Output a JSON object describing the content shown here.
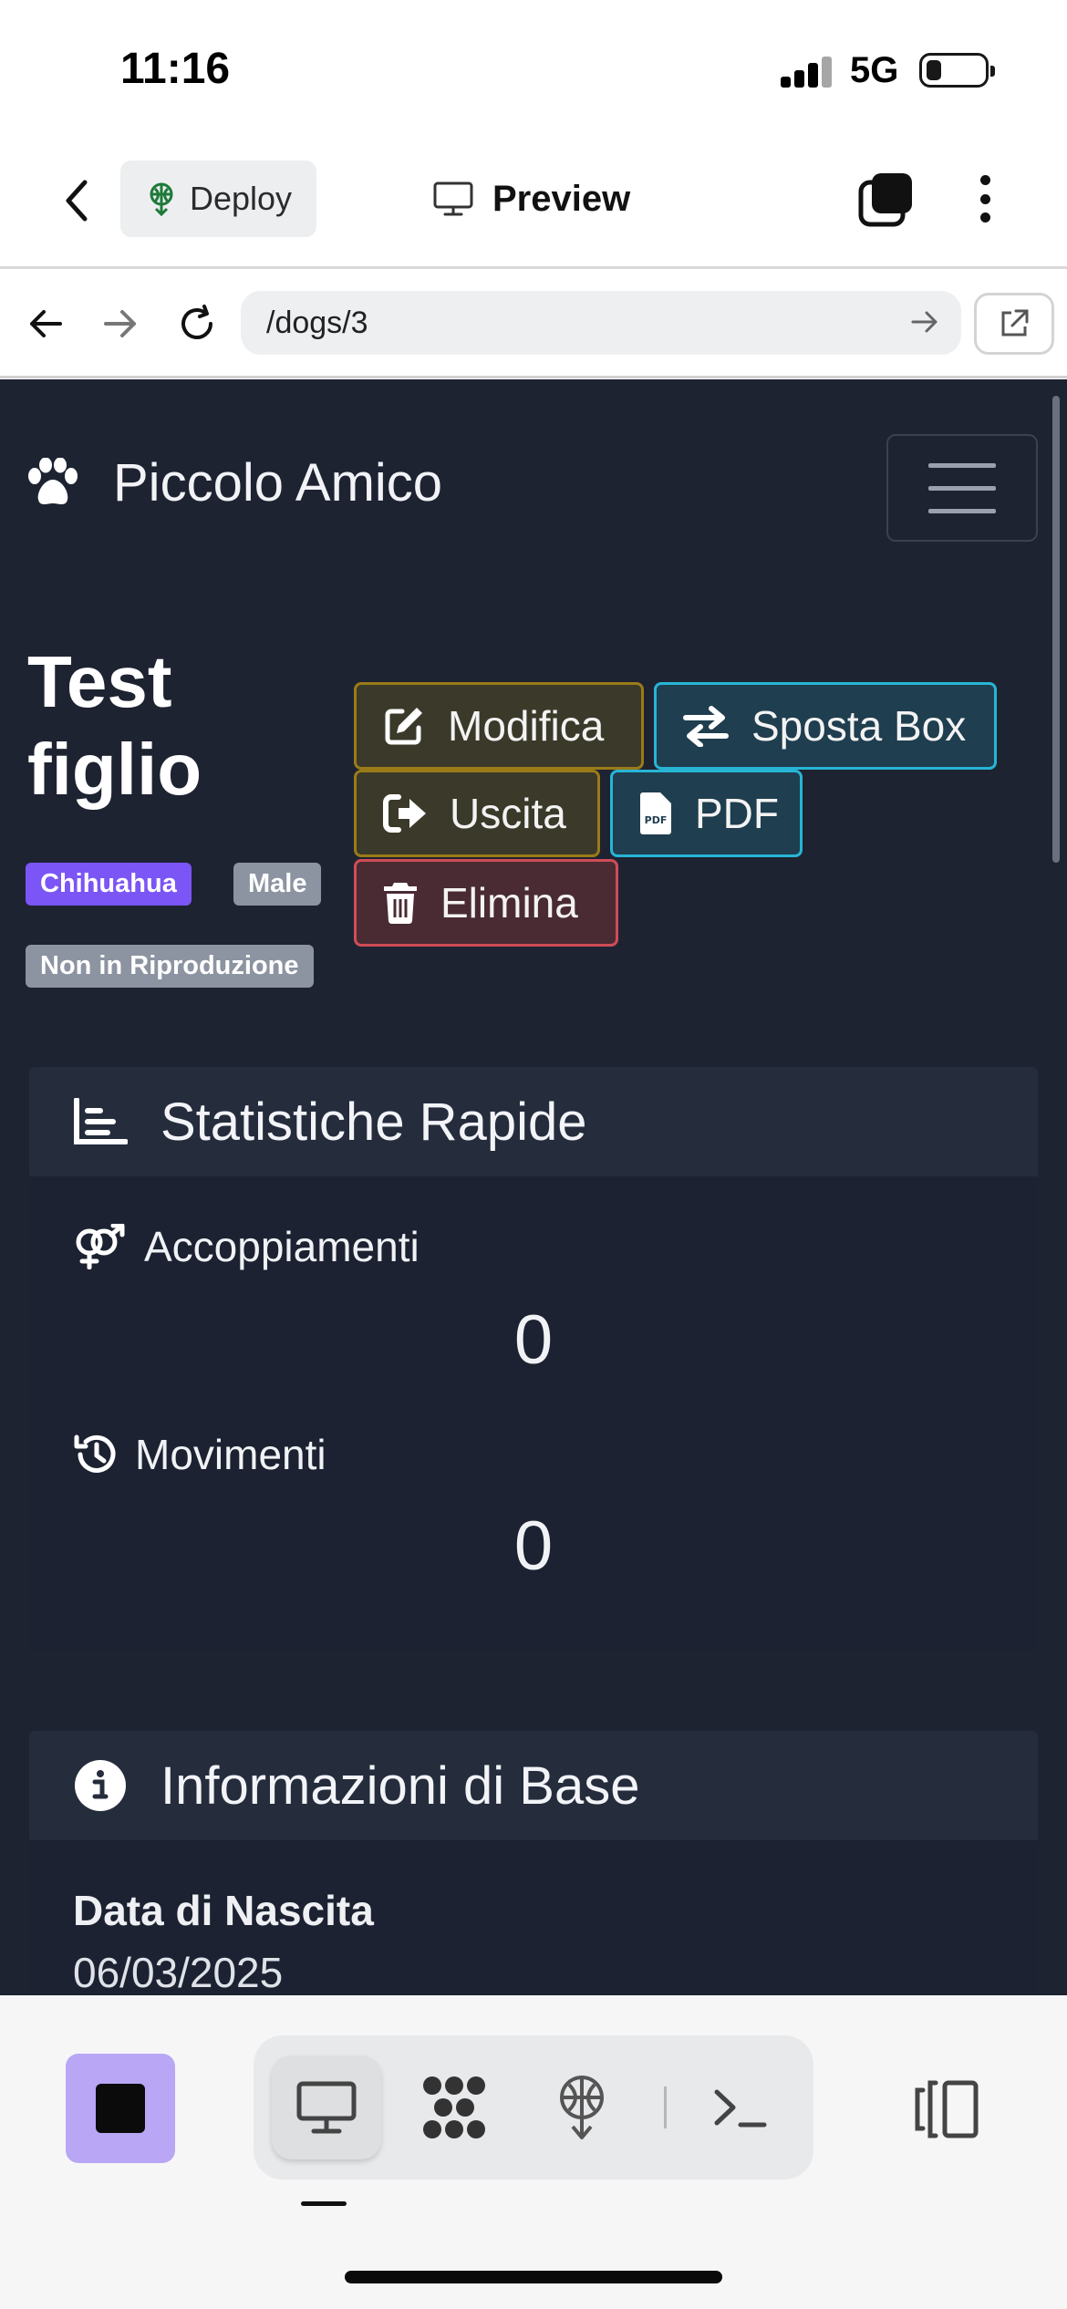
{
  "status_bar": {
    "time": "11:16",
    "network": "5G"
  },
  "app_toolbar": {
    "deploy_label": "Deploy",
    "preview_label": "Preview"
  },
  "browser": {
    "url": "/dogs/3"
  },
  "site": {
    "brand_name": "Piccolo Amico",
    "icons": {
      "brand": "paw-icon",
      "menu": "hamburger-icon"
    }
  },
  "dog": {
    "name": "Test figlio",
    "badges": {
      "breed": "Chihuahua",
      "sex": "Male",
      "breeding_status": "Non in Riproduzione"
    },
    "actions": {
      "edit": "Modifica",
      "move_box": "Sposta Box",
      "exit": "Uscita",
      "pdf": "PDF",
      "delete": "Elimina"
    }
  },
  "quick_stats": {
    "title": "Statistiche Rapide",
    "matings_label": "Accoppiamenti",
    "matings_value": "0",
    "movements_label": "Movimenti",
    "movements_value": "0"
  },
  "basic_info": {
    "title": "Informazioni di Base",
    "birth_date_label": "Data di Nascita",
    "birth_date_value": "06/03/2025"
  },
  "colors": {
    "page_bg": "#1e2332",
    "primary_badge": "#7b55f5",
    "secondary_badge": "#8c93a1",
    "warning_border": "#9a7b18",
    "info_border": "#27b5d5",
    "danger_border": "#d04d56",
    "stop_button": "#b9a6f5"
  }
}
